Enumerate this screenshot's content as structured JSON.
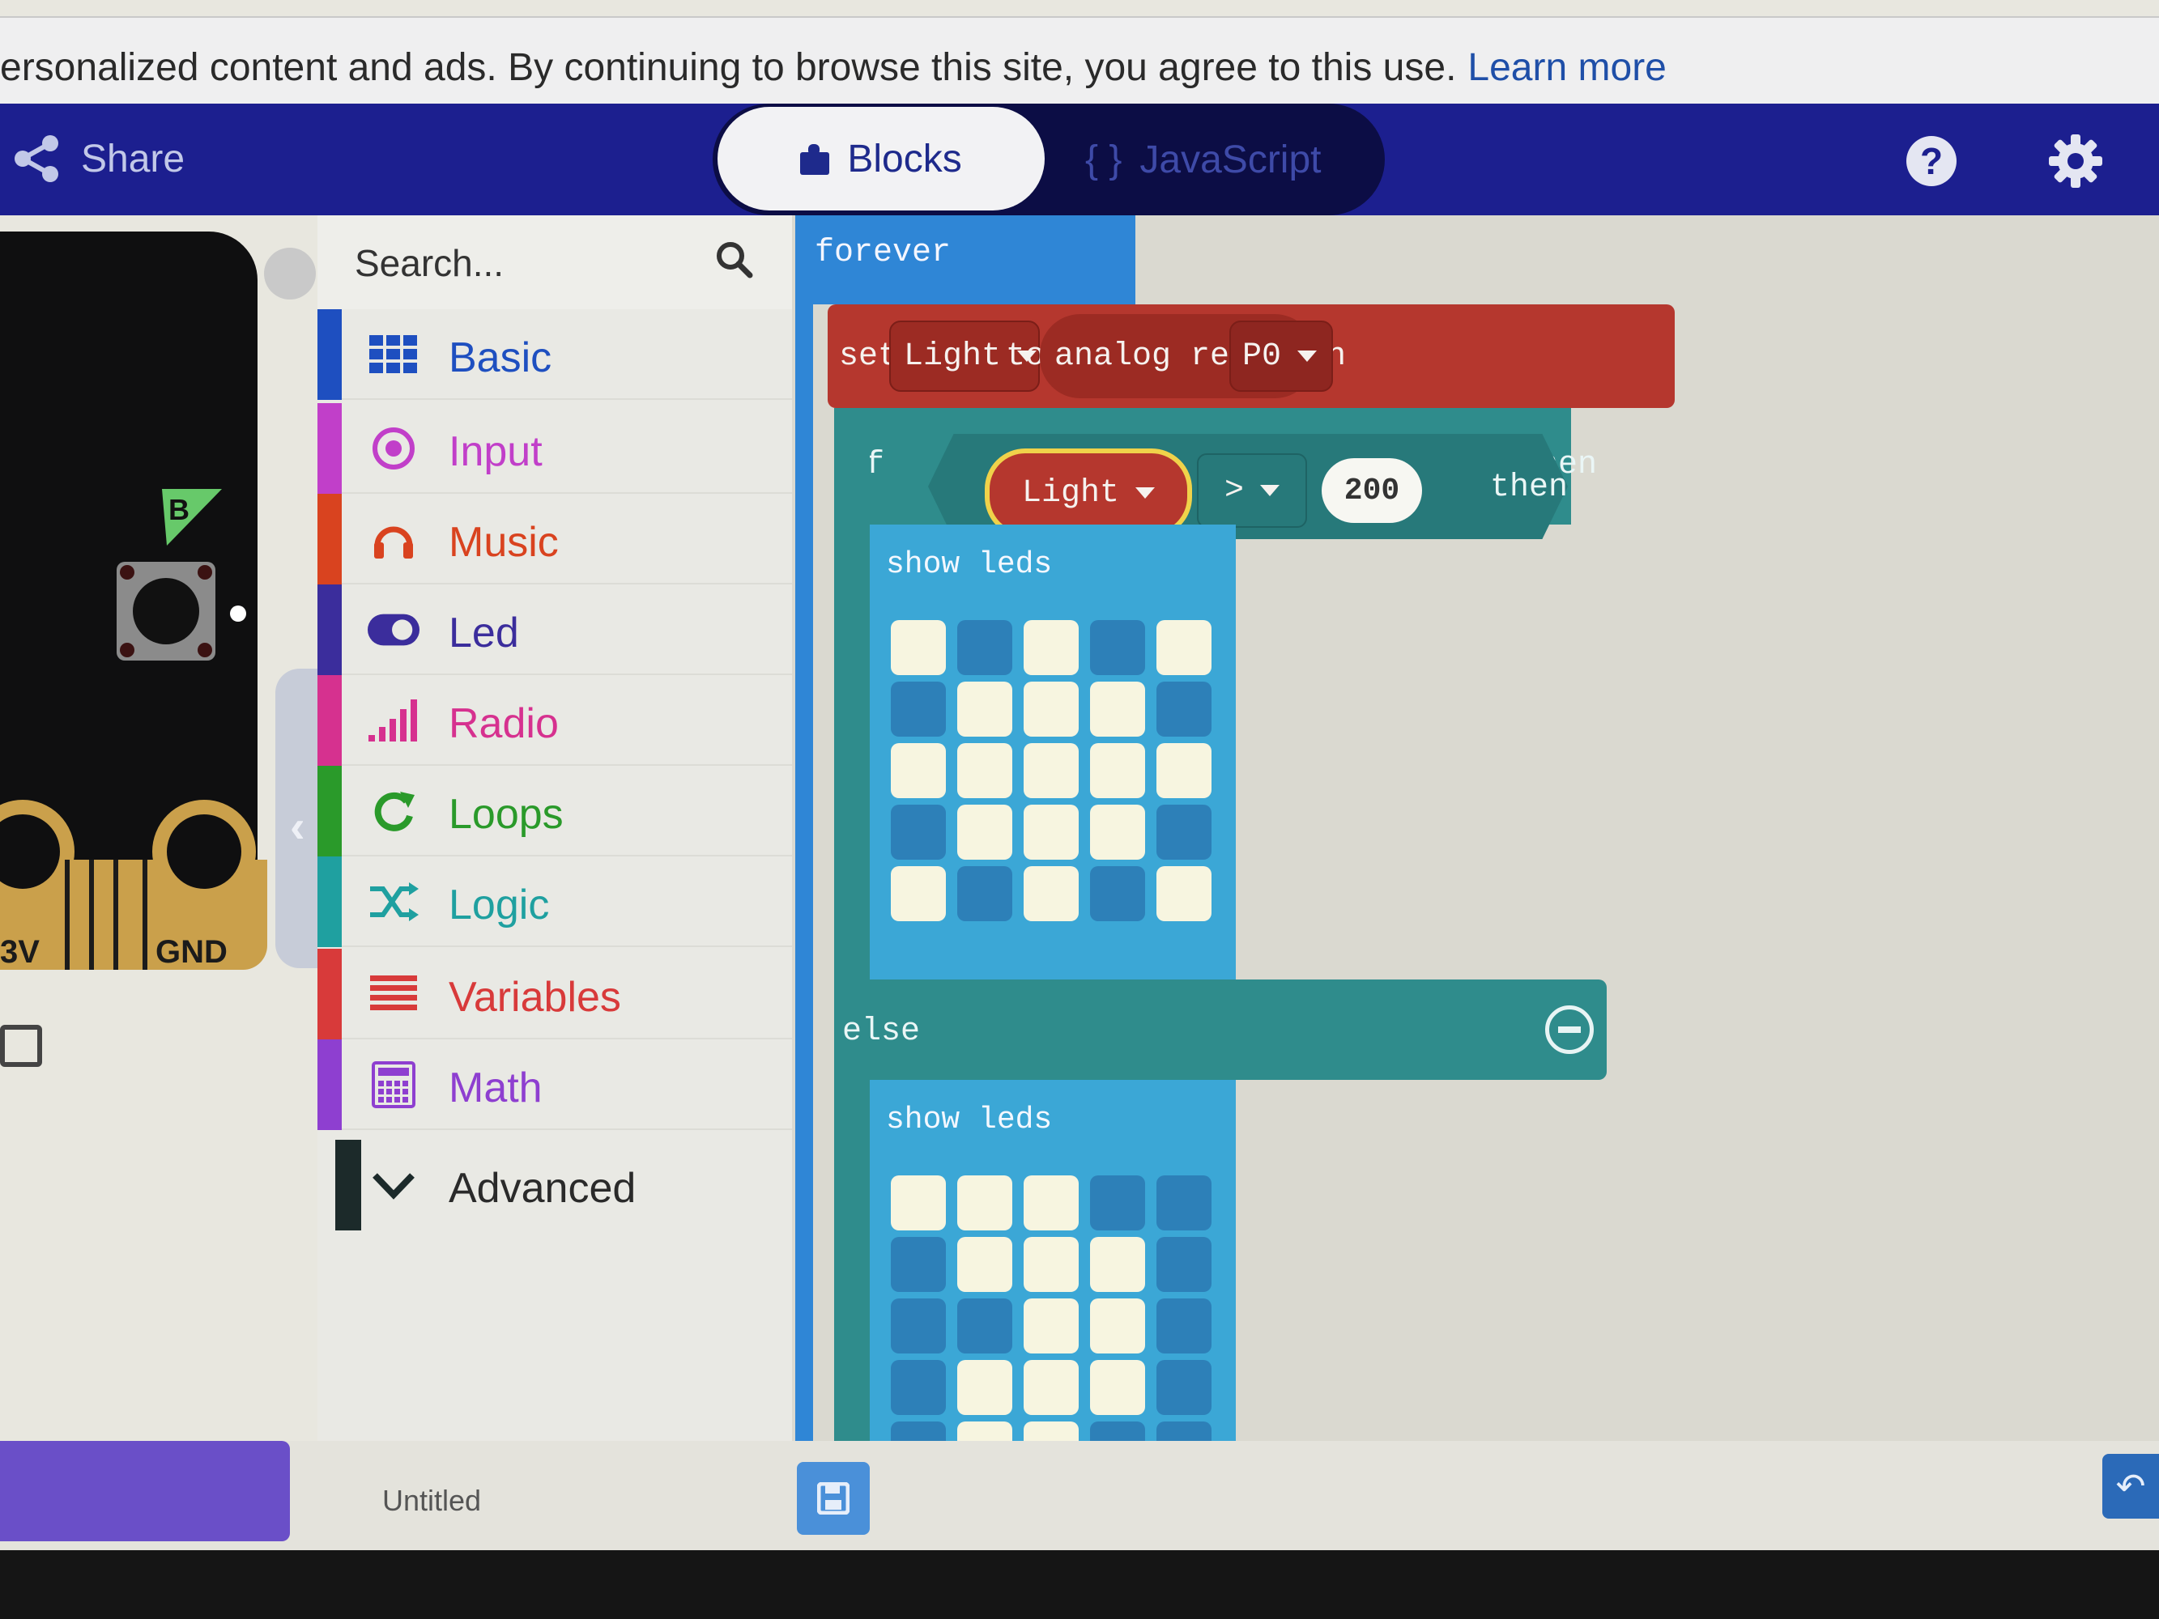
{
  "cookie_banner": {
    "text": "ersonalized content and ads. By continuing to browse this site, you agree to this use.",
    "link": "Learn more"
  },
  "menu": {
    "share_label": "Share",
    "blocks_label": "Blocks",
    "javascript_label": "JavaScript",
    "javascript_brace": "{ }",
    "help_label": "?"
  },
  "simulator": {
    "button_b_label": "B",
    "pin_3v": "3V",
    "pin_gnd": "GND"
  },
  "search": {
    "placeholder": "Search..."
  },
  "toolbox": [
    {
      "label": "Basic",
      "color": "#1e4fc0",
      "icon": "grid-icon"
    },
    {
      "label": "Input",
      "color": "#c13fc9",
      "icon": "target-icon"
    },
    {
      "label": "Music",
      "color": "#d9431f",
      "icon": "headphones-icon"
    },
    {
      "label": "Led",
      "color": "#3b2d9c",
      "icon": "toggle-icon"
    },
    {
      "label": "Radio",
      "color": "#d6318f",
      "icon": "signal-bars-icon"
    },
    {
      "label": "Loops",
      "color": "#2a9a2a",
      "icon": "loop-arrow-icon"
    },
    {
      "label": "Logic",
      "color": "#1fa0a0",
      "icon": "shuffle-icon"
    },
    {
      "label": "Variables",
      "color": "#d83a3a",
      "icon": "lines-icon"
    },
    {
      "label": "Math",
      "color": "#8e3fd0",
      "icon": "calculator-icon"
    },
    {
      "label": "Advanced",
      "color": "#1c2a2a",
      "icon": "chevron-down-icon"
    }
  ],
  "workspace": {
    "forever_label": "forever",
    "set_keyword": "set",
    "set_variable": "Light",
    "to_keyword": "to",
    "analog_read_label": "analog read pin",
    "pin_value": "P0",
    "if_keyword": "if",
    "condition_variable": "Light",
    "operator": ">",
    "threshold": "200",
    "then_keyword": "then",
    "show_leds_label": "show leds",
    "else_keyword": "else",
    "leds_then": [
      [
        1,
        0,
        1,
        0,
        1
      ],
      [
        0,
        1,
        1,
        1,
        0
      ],
      [
        1,
        1,
        1,
        1,
        1
      ],
      [
        0,
        1,
        1,
        1,
        0
      ],
      [
        1,
        0,
        1,
        0,
        1
      ]
    ],
    "leds_else": [
      [
        1,
        1,
        1,
        0,
        0
      ],
      [
        0,
        1,
        1,
        1,
        0
      ],
      [
        0,
        0,
        1,
        1,
        0
      ],
      [
        0,
        1,
        1,
        1,
        0
      ],
      [
        0,
        1,
        1,
        0,
        0
      ]
    ]
  },
  "bottom": {
    "project_name": "Untitled"
  }
}
